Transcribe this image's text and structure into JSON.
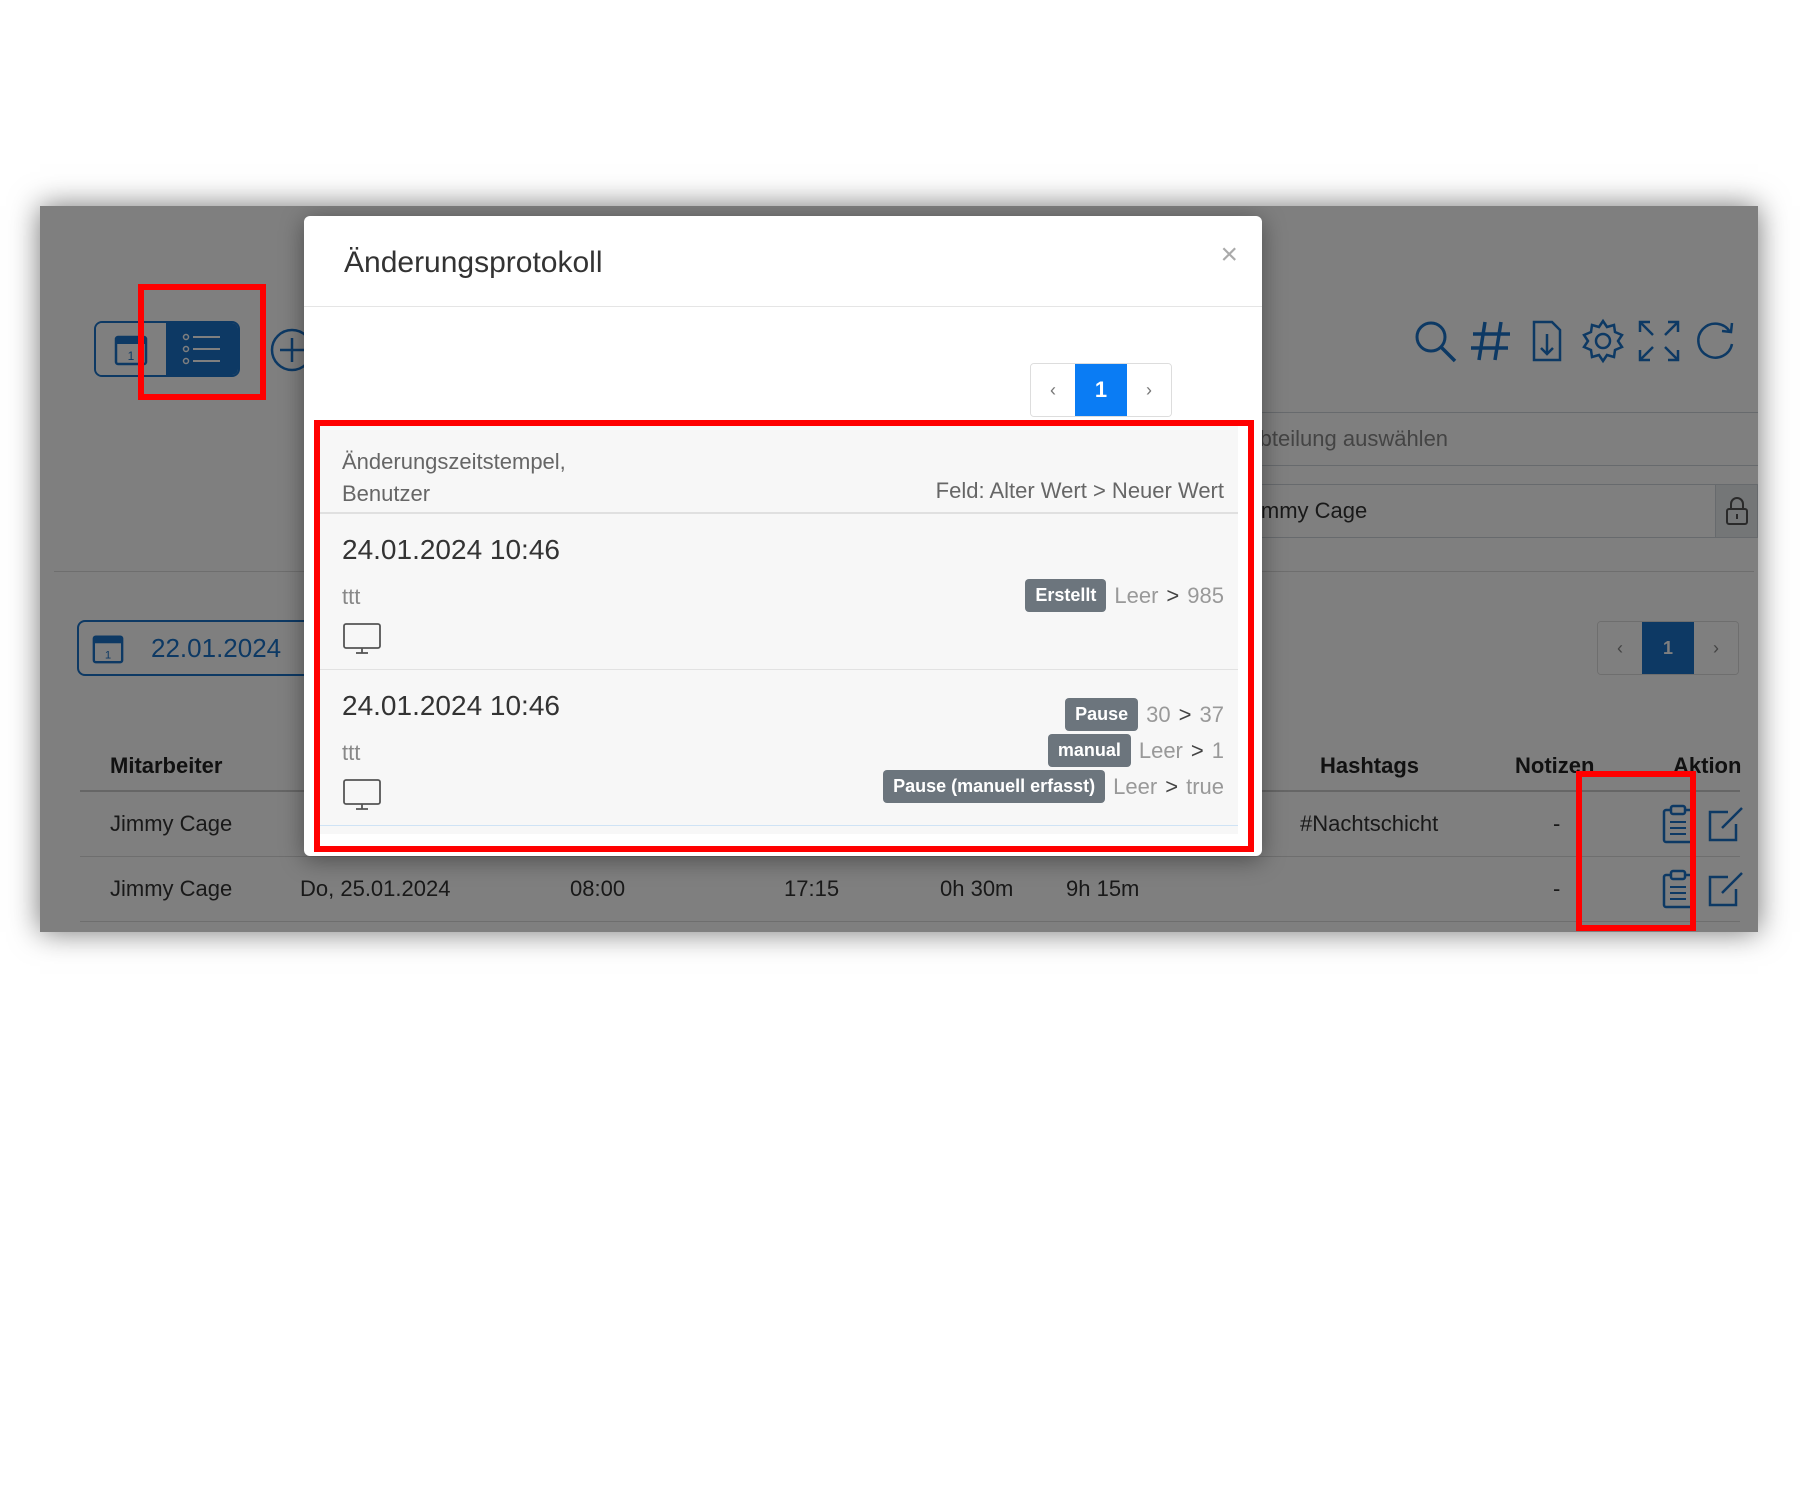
{
  "background": {
    "add_icon": "plus-circle-icon",
    "toolbar_icons": [
      "search-icon",
      "hashtag-icon",
      "export-icon",
      "gear-icon",
      "fullscreen-icon",
      "refresh-icon"
    ],
    "department_placeholder": "Abteilung auswählen",
    "user_value": "Jimmy Cage",
    "date_value": "22.01.2024",
    "pagination": {
      "prev": "‹",
      "current": "1",
      "next": "›"
    },
    "table": {
      "headers": {
        "employee": "Mitarbeiter",
        "hashtags": "Hashtags",
        "notes": "Notizen",
        "action": "Aktion"
      },
      "rows": [
        {
          "employee": "Jimmy Cage",
          "date": "",
          "start": "",
          "end": "",
          "pause": "",
          "total": "",
          "hashtags": "#Nachtschicht",
          "notes": "-"
        },
        {
          "employee": "Jimmy Cage",
          "date": "Do, 25.01.2024",
          "start": "08:00",
          "end": "17:15",
          "pause": "0h 30m",
          "total": "9h 15m",
          "hashtags": "",
          "notes": "-"
        }
      ]
    }
  },
  "modal": {
    "title": "Änderungsprotokoll",
    "close": "×",
    "pagination": {
      "prev": "‹",
      "current": "1",
      "next": "›"
    },
    "header_left_line1": "Änderungszeitstempel,",
    "header_left_line2": "Benutzer",
    "header_right": "Feld: Alter Wert > Neuer Wert",
    "entries": [
      {
        "timestamp": "24.01.2024 10:46",
        "user": "ttt",
        "device_icon": "monitor-icon",
        "changes": [
          {
            "field": "Erstellt",
            "old": "Leer",
            "sep": ">",
            "new": "985"
          }
        ]
      },
      {
        "timestamp": "24.01.2024 10:46",
        "user": "ttt",
        "device_icon": "monitor-icon",
        "changes": [
          {
            "field": "Pause",
            "old": "30",
            "sep": ">",
            "new": "37"
          },
          {
            "field": "manual",
            "old": "Leer",
            "sep": ">",
            "new": "1"
          },
          {
            "field": "Pause (manuell erfasst)",
            "old": "Leer",
            "sep": ">",
            "new": "true"
          }
        ]
      }
    ]
  },
  "colors": {
    "primary": "#1a73c8",
    "highlight": "#ff0000",
    "badge": "#6c757d",
    "active_page": "#0a7cf4"
  }
}
